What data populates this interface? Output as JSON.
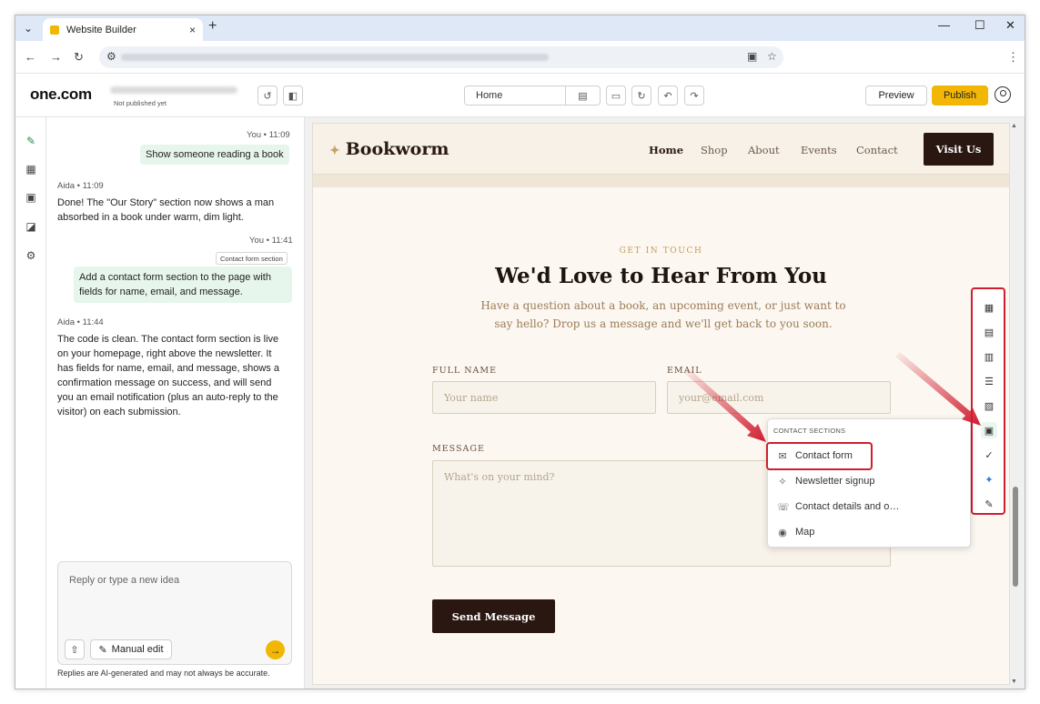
{
  "browser": {
    "tab_title": "Website Builder",
    "new_tab": "+",
    "tab_close": "×"
  },
  "app": {
    "logo": "one.com",
    "status": "Not published yet",
    "page_select": "Home",
    "preview_label": "Preview",
    "publish_label": "Publish",
    "accent": "#f2b705"
  },
  "chat": {
    "messages": [
      {
        "meta": "You • 11:09",
        "text": "Show someone reading a book"
      },
      {
        "meta": "Aida • 11:09",
        "text": "Done! The \"Our Story\" section now shows a man absorbed in a book under warm, dim light."
      },
      {
        "meta": "You • 11:41",
        "chip": "Contact form section",
        "text": "Add a contact form section to the page with fields for name, email, and message."
      },
      {
        "meta": "Aida • 11:44",
        "text": "The code is clean. The contact form section is live on your homepage, right above the newsletter. It has fields for name, email, and message, shows a confirmation message on success, and will send you an email notification (plus an auto-reply to the visitor) on each submission."
      }
    ],
    "input_placeholder": "Reply or type a new idea",
    "manual_edit_label": "Manual edit",
    "disclaimer": "Replies are AI-generated and may not always be accurate."
  },
  "site": {
    "brand": "Bookworm",
    "brand_mark": "✦",
    "nav": [
      "Home",
      "Shop",
      "About",
      "Events",
      "Contact"
    ],
    "cta": "Visit Us",
    "eyebrow": "GET IN TOUCH",
    "heading": "We'd Love to Hear From You",
    "subtext": "Have a question about a book, an upcoming event, or just want to say hello? Drop us a message and we'll get back to you soon.",
    "form": {
      "name_label": "FULL NAME",
      "name_placeholder": "Your name",
      "email_label": "EMAIL",
      "email_placeholder": "your@email.com",
      "message_label": "MESSAGE",
      "message_placeholder": "What's on your mind?",
      "submit_label": "Send Message"
    }
  },
  "dropdown": {
    "heading": "CONTACT SECTIONS",
    "items": [
      {
        "label": "Contact form",
        "icon": "envelope-icon"
      },
      {
        "label": "Newsletter signup",
        "icon": "megaphone-icon"
      },
      {
        "label": "Contact details and o…",
        "icon": "phone-icon"
      },
      {
        "label": "Map",
        "icon": "map-pin-icon"
      }
    ]
  },
  "highlight_color": "#d01d2f"
}
